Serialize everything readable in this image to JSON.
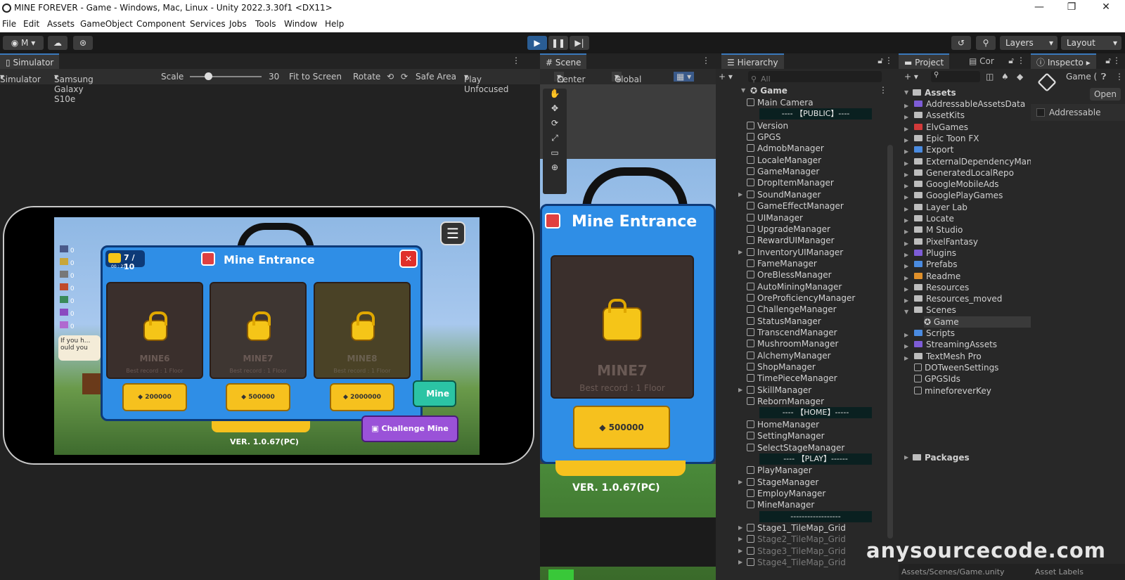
{
  "window": {
    "title": "MINE  FOREVER - Game - Windows, Mac, Linux - Unity 2022.3.30f1 <DX11>",
    "minimize": "—",
    "maximize": "❐",
    "close": "✕"
  },
  "menu": [
    "File",
    "Edit",
    "Assets",
    "GameObject",
    "Component",
    "Services",
    "Jobs",
    "Tools",
    "Window",
    "Help"
  ],
  "toolbar": {
    "account": "M",
    "layers": "Layers",
    "layout": "Layout"
  },
  "simulator": {
    "tab": "Simulator",
    "mode": "Simulator",
    "device": "Samsung Galaxy S10e",
    "scale_label": "Scale",
    "scale_value": "30",
    "scale_fraction": 0.25,
    "fit": "Fit to Screen",
    "rotate": "Rotate",
    "safe_area": "Safe Area",
    "play_focus": "Play Unfocused"
  },
  "game": {
    "keys": "7 / 10",
    "timer": "00 : 27",
    "popup_title": "Mine Entrance",
    "mines": [
      {
        "name": "MINE6",
        "record": "Best record : 1 Floor",
        "cost": "200000"
      },
      {
        "name": "MINE7",
        "record": "Best record : 1 Floor",
        "cost": "500000"
      },
      {
        "name": "MINE8",
        "record": "Best record : 1 Floor",
        "cost": "2000000"
      }
    ],
    "mine_btn": "Mine",
    "challenge_btn": "Challenge Mine",
    "version": "VER. 1.0.67(PC)",
    "chat": "If you h... ould you",
    "res_counts": [
      "0",
      "0",
      "0",
      "0",
      "0",
      "0",
      "0"
    ]
  },
  "scene": {
    "tab": "Scene",
    "pivot": "Center",
    "space": "Global",
    "title": "Mine Entrance",
    "mine": "MINE7",
    "record": "Best record : 1 Floor",
    "cost": "500000",
    "version": "VER. 1.0.67(PC)"
  },
  "hierarchy": {
    "tab": "Hierarchy",
    "search": "All",
    "root": "Game",
    "items": [
      {
        "t": "Main Camera",
        "kind": "obj"
      },
      {
        "t": "---- 【PUBLIC】----",
        "kind": "sep"
      },
      {
        "t": "Version",
        "kind": "obj"
      },
      {
        "t": "GPGS",
        "kind": "obj"
      },
      {
        "t": "AdmobManager",
        "kind": "obj"
      },
      {
        "t": "LocaleManager",
        "kind": "obj"
      },
      {
        "t": "GameManager",
        "kind": "obj"
      },
      {
        "t": "DropItemManager",
        "kind": "obj"
      },
      {
        "t": "SoundManager",
        "kind": "obj",
        "exp": true
      },
      {
        "t": "GameEffectManager",
        "kind": "obj"
      },
      {
        "t": "UIManager",
        "kind": "obj"
      },
      {
        "t": "UpgradeManager",
        "kind": "obj"
      },
      {
        "t": "RewardUIManager",
        "kind": "obj"
      },
      {
        "t": "InventoryUIManager",
        "kind": "obj",
        "exp": true
      },
      {
        "t": "FameManager",
        "kind": "obj"
      },
      {
        "t": "OreBlessManager",
        "kind": "obj"
      },
      {
        "t": "AutoMiningManager",
        "kind": "obj"
      },
      {
        "t": "OreProficiencyManager",
        "kind": "obj"
      },
      {
        "t": "ChallengeManager",
        "kind": "obj"
      },
      {
        "t": "StatusManager",
        "kind": "obj"
      },
      {
        "t": "TranscendManager",
        "kind": "obj"
      },
      {
        "t": "MushroomManager",
        "kind": "obj"
      },
      {
        "t": "AlchemyManager",
        "kind": "obj"
      },
      {
        "t": "ShopManager",
        "kind": "obj"
      },
      {
        "t": "TimePieceManager",
        "kind": "obj"
      },
      {
        "t": "SkillManager",
        "kind": "obj",
        "exp": true
      },
      {
        "t": "RebornManager",
        "kind": "obj"
      },
      {
        "t": "---- 【HOME】-----",
        "kind": "sep"
      },
      {
        "t": "HomeManager",
        "kind": "obj"
      },
      {
        "t": "SettingManager",
        "kind": "obj"
      },
      {
        "t": "SelectStageManager",
        "kind": "obj"
      },
      {
        "t": "---- 【PLAY】------",
        "kind": "sep"
      },
      {
        "t": "PlayManager",
        "kind": "obj"
      },
      {
        "t": "StageManager",
        "kind": "obj",
        "exp": true
      },
      {
        "t": "EmployManager",
        "kind": "obj"
      },
      {
        "t": "MineManager",
        "kind": "obj"
      },
      {
        "t": "------------------",
        "kind": "sep"
      },
      {
        "t": "Stage1_TileMap_Grid",
        "kind": "obj",
        "exp": true
      },
      {
        "t": "Stage2_TileMap_Grid",
        "kind": "dim",
        "exp": true
      },
      {
        "t": "Stage3_TileMap_Grid",
        "kind": "dim",
        "exp": true
      },
      {
        "t": "Stage4_TileMap_Grid",
        "kind": "dim",
        "exp": true
      }
    ]
  },
  "project": {
    "tab": "Project",
    "tab2": "Cor",
    "root": "Assets",
    "items": [
      {
        "t": "AddressableAssetsData",
        "c": "#7d5cd6"
      },
      {
        "t": "AssetKits",
        "c": "#bdbdbd"
      },
      {
        "t": "ElvGames",
        "c": "#d23a3a"
      },
      {
        "t": "Epic Toon FX",
        "c": "#bdbdbd"
      },
      {
        "t": "Export",
        "c": "#4a8be0"
      },
      {
        "t": "ExternalDependencyManager",
        "c": "#bdbdbd"
      },
      {
        "t": "GeneratedLocalRepo",
        "c": "#bdbdbd"
      },
      {
        "t": "GoogleMobileAds",
        "c": "#bdbdbd"
      },
      {
        "t": "GooglePlayGames",
        "c": "#bdbdbd"
      },
      {
        "t": "Layer Lab",
        "c": "#bdbdbd"
      },
      {
        "t": "Locate",
        "c": "#bdbdbd"
      },
      {
        "t": "M Studio",
        "c": "#bdbdbd"
      },
      {
        "t": "PixelFantasy",
        "c": "#bdbdbd"
      },
      {
        "t": "Plugins",
        "c": "#7d5cd6"
      },
      {
        "t": "Prefabs",
        "c": "#4a8be0"
      },
      {
        "t": "Readme",
        "c": "#e0902a"
      },
      {
        "t": "Resources",
        "c": "#bdbdbd"
      },
      {
        "t": "Resources_moved",
        "c": "#bdbdbd"
      },
      {
        "t": "Scenes",
        "c": "#bdbdbd"
      },
      {
        "t": "Game",
        "c": "scene"
      },
      {
        "t": "Scripts",
        "c": "#4a8be0"
      },
      {
        "t": "StreamingAssets",
        "c": "#7d5cd6"
      },
      {
        "t": "TextMesh Pro",
        "c": "#bdbdbd"
      },
      {
        "t": "DOTweenSettings",
        "c": "file"
      },
      {
        "t": "GPGSIds",
        "c": "file"
      },
      {
        "t": "mineforeverKey",
        "c": "file"
      }
    ],
    "packages": "Packages",
    "footer": "Assets/Scenes/Game.unity"
  },
  "inspector": {
    "tab": "Inspecto",
    "object": "Game (",
    "open": "Open",
    "addressable": "Addressable",
    "footer": "Asset Labels"
  },
  "watermark": "anysourcecode.com"
}
